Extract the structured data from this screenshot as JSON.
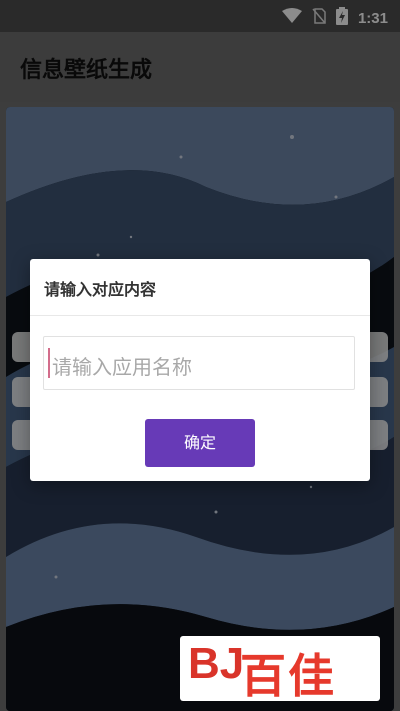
{
  "status_bar": {
    "time": "1:31"
  },
  "app_bar": {
    "title": "信息壁纸生成"
  },
  "dialog": {
    "title": "请输入对应内容",
    "input_placeholder": "请输入应用名称",
    "confirm_label": "确定"
  },
  "watermark": {
    "brand_text": "百佳",
    "brand_mark": "BJ"
  },
  "colors": {
    "accent": "#673ab7",
    "caret": "#d36d8b"
  }
}
